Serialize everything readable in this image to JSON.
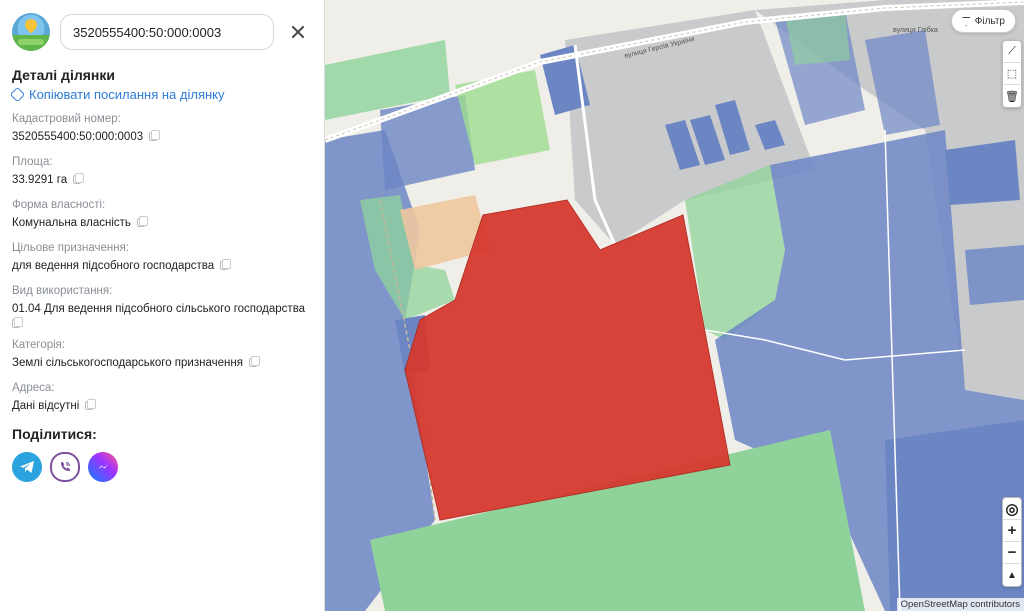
{
  "search": {
    "value": "3520555400:50:000:0003"
  },
  "details": {
    "title": "Деталі ділянки",
    "copy_link": "Копіювати посилання на ділянку",
    "fields": [
      {
        "label": "Кадастровий номер:",
        "value": "3520555400:50:000:0003"
      },
      {
        "label": "Площа:",
        "value": "33.9291 га"
      },
      {
        "label": "Форма власності:",
        "value": "Комунальна власність"
      },
      {
        "label": "Цільове призначення:",
        "value": "для ведення підсобного господарства"
      },
      {
        "label": "Вид використання:",
        "value": "01.04 Для ведення підсобного сільського господарства"
      },
      {
        "label": "Категорія:",
        "value": "Землі сільськогосподарського призначення"
      },
      {
        "label": "Адреса:",
        "value": "Дані відсутні"
      }
    ]
  },
  "share": {
    "title": "Поділитися:",
    "targets": [
      "telegram-icon",
      "viber-icon",
      "messenger-icon"
    ]
  },
  "map": {
    "filter_label": "Фільтр",
    "street_label_1": "вулиця Героїв України",
    "street_label_2": "вулиця Глібка",
    "attribution": "OpenStreetMap contributors",
    "colors": {
      "selected_parcel": "#d63a2f",
      "agricultural": "#8fd39a",
      "residential": "#6c86c4",
      "industrial": "#c9cacc",
      "commercial": "#eec69e"
    }
  }
}
